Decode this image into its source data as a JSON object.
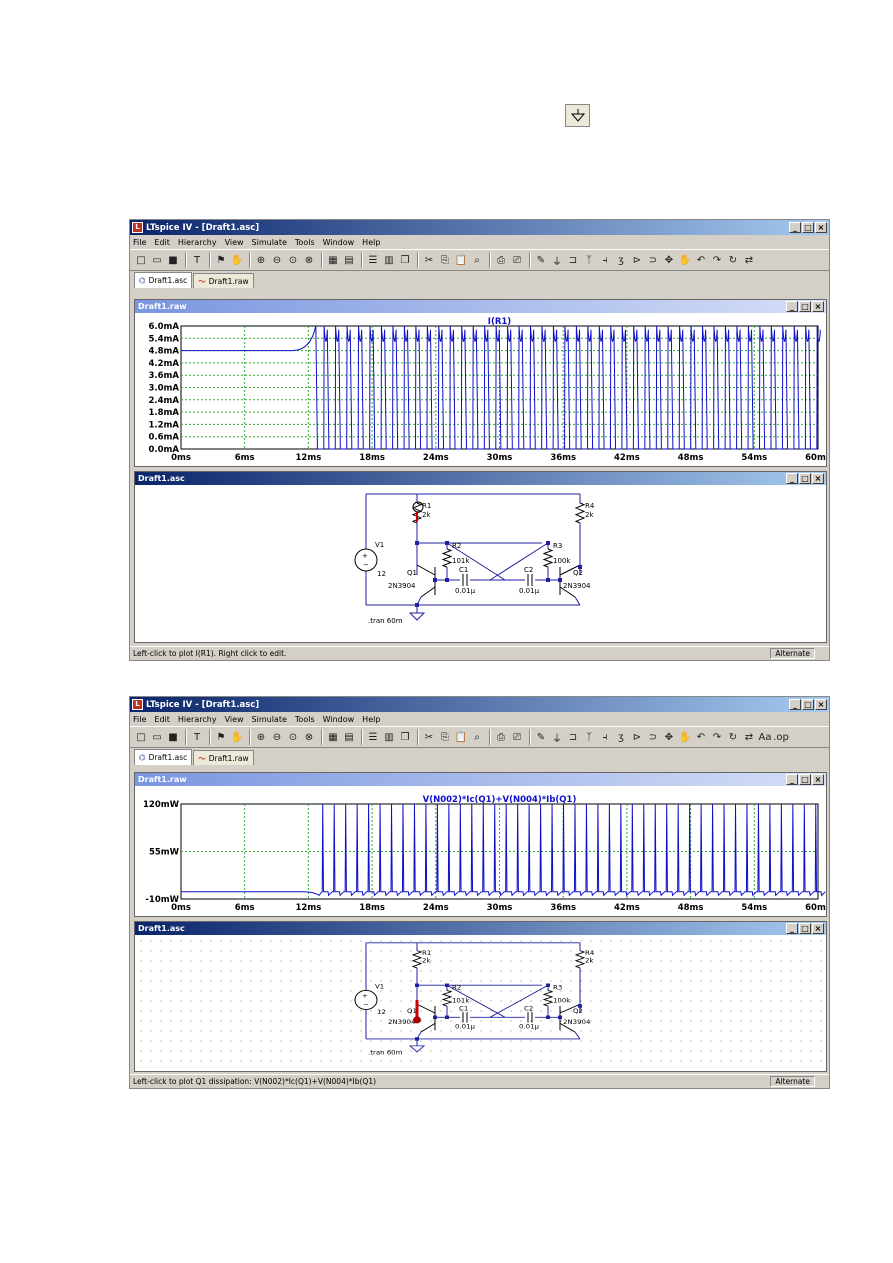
{
  "window1": {
    "title": "LTspice IV - [Draft1.asc]",
    "menu": [
      "File",
      "Edit",
      "Hierarchy",
      "View",
      "Simulate",
      "Tools",
      "Window",
      "Help"
    ],
    "tabs": [
      "Draft1.asc",
      "Draft1.raw"
    ],
    "plot_title": "Draft1.raw",
    "trace": "I(R1)",
    "schematic_title": "Draft1.asc",
    "status": "Left-click to plot I(R1).  Right click to edit.",
    "status_right": "Alternate",
    "components": {
      "r1": "R1",
      "r1v": "2k",
      "r2": "R2",
      "r2v": "101k",
      "r3": "R3",
      "r3v": "100k",
      "r4": "R4",
      "r4v": "2k",
      "c1": "C1",
      "c1v": "0.01µ",
      "c2": "C2",
      "c2v": "0.01µ",
      "q1": "Q1",
      "q1m": "2N3904",
      "q2": "Q2",
      "q2m": "2N3904",
      "v1": "V1",
      "v1v": "12",
      "tran": ".tran 60m"
    }
  },
  "window2": {
    "title": "LTspice IV - [Draft1.asc]",
    "menu": [
      "File",
      "Edit",
      "Hierarchy",
      "View",
      "Simulate",
      "Tools",
      "Window",
      "Help"
    ],
    "tabs": [
      "Draft1.asc",
      "Draft1.raw"
    ],
    "plot_title": "Draft1.raw",
    "trace": "V(N002)*Ic(Q1)+V(N004)*Ib(Q1)",
    "schematic_title": "Draft1.asc",
    "status": "Left-click to plot Q1 dissipation: V(N002)*Ic(Q1)+V(N004)*Ib(Q1)",
    "status_right": "Alternate",
    "components": {
      "r1": "R1",
      "r1v": "2k",
      "r2": "R2",
      "r2v": "101k",
      "r3": "R3",
      "r3v": "100k",
      "r4": "R4",
      "r4v": "2k",
      "c1": "C1",
      "c1v": "0.01µ",
      "c2": "C2",
      "c2v": "0.01µ",
      "q1": "Q1",
      "q1m": "2N3904",
      "q2": "Q2",
      "q2m": "2N3904",
      "v1": "V1",
      "v1v": "12",
      "tran": ".tran 60m"
    }
  },
  "chart_data": [
    {
      "type": "line",
      "title": "I(R1)",
      "x_ticks": [
        "0ms",
        "6ms",
        "12ms",
        "18ms",
        "24ms",
        "30ms",
        "36ms",
        "42ms",
        "48ms",
        "54ms",
        "60ms"
      ],
      "y_ticks": [
        "6.0mA",
        "5.4mA",
        "4.8mA",
        "4.2mA",
        "3.6mA",
        "3.0mA",
        "2.4mA",
        "1.8mA",
        "1.2mA",
        "0.6mA",
        "0.0mA"
      ],
      "xlim": [
        0,
        60
      ],
      "ylim": [
        0,
        6.0
      ],
      "baseline_before_12ms": 4.8,
      "pulse_low": 0,
      "pulse_high": 6.0,
      "color": "#1010c8"
    },
    {
      "type": "line",
      "title": "V(N002)*Ic(Q1)+V(N004)*Ib(Q1)",
      "x_ticks": [
        "0ms",
        "6ms",
        "12ms",
        "18ms",
        "24ms",
        "30ms",
        "36ms",
        "42ms",
        "48ms",
        "54ms",
        "60ms"
      ],
      "y_ticks": [
        "120mW",
        "55mW",
        "-10mW"
      ],
      "xlim": [
        0,
        60
      ],
      "ylim": [
        -10,
        120
      ],
      "baseline": 0,
      "spike_peak": 120,
      "color": "#1010c8"
    }
  ],
  "icons": {
    "ground": "ground-icon"
  }
}
